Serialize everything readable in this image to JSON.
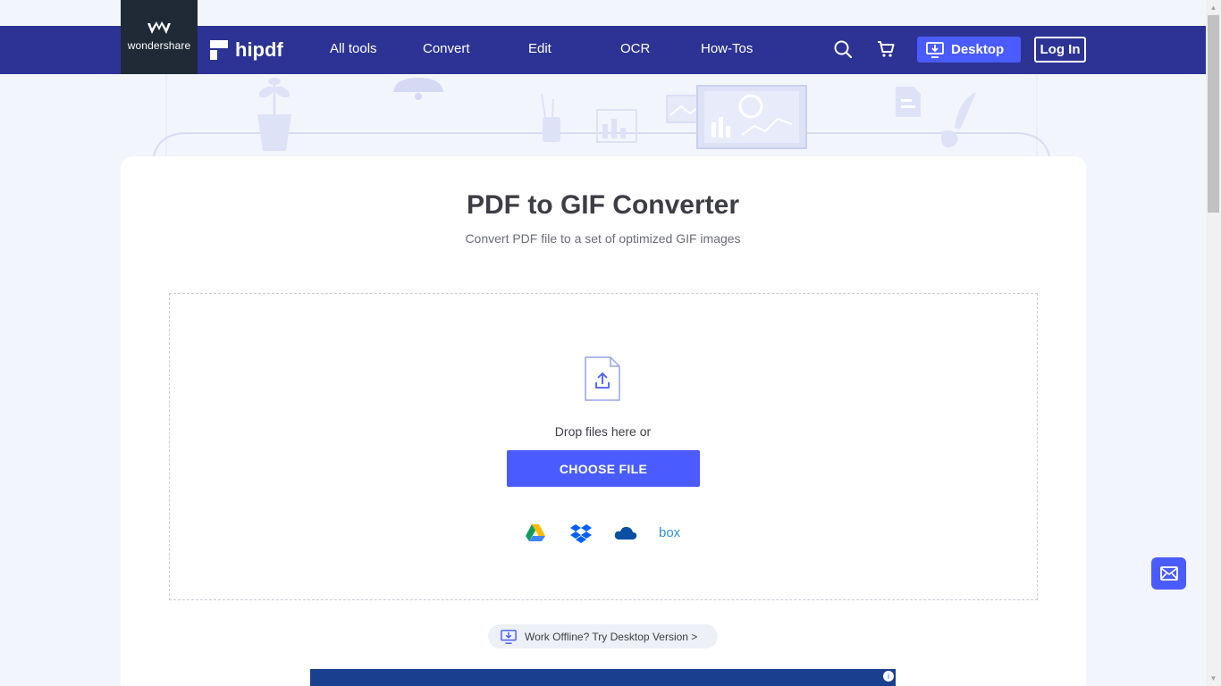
{
  "brand": {
    "wondershare": "wondershare",
    "hipdf": "hipdf"
  },
  "nav": {
    "items": [
      {
        "label": "All tools"
      },
      {
        "label": "Convert"
      },
      {
        "label": "Edit"
      },
      {
        "label": "OCR"
      },
      {
        "label": "How-Tos"
      }
    ],
    "desktop_label": "Desktop",
    "login_label": "Log In"
  },
  "main": {
    "title": "PDF to GIF Converter",
    "subtitle": "Convert PDF file to a set of optimized GIF images",
    "drop_text": "Drop files here or",
    "choose_label": "CHOOSE FILE",
    "cloud_sources": [
      "google-drive-icon",
      "dropbox-icon",
      "onedrive-icon",
      "box-icon"
    ],
    "box_label": "box"
  },
  "offline": {
    "label": "Work Offline? Try Desktop Version >"
  },
  "ad": {
    "info": "i"
  },
  "colors": {
    "nav": "#2d3394",
    "accent": "#4a5cff",
    "bg": "#f3f5fc"
  }
}
